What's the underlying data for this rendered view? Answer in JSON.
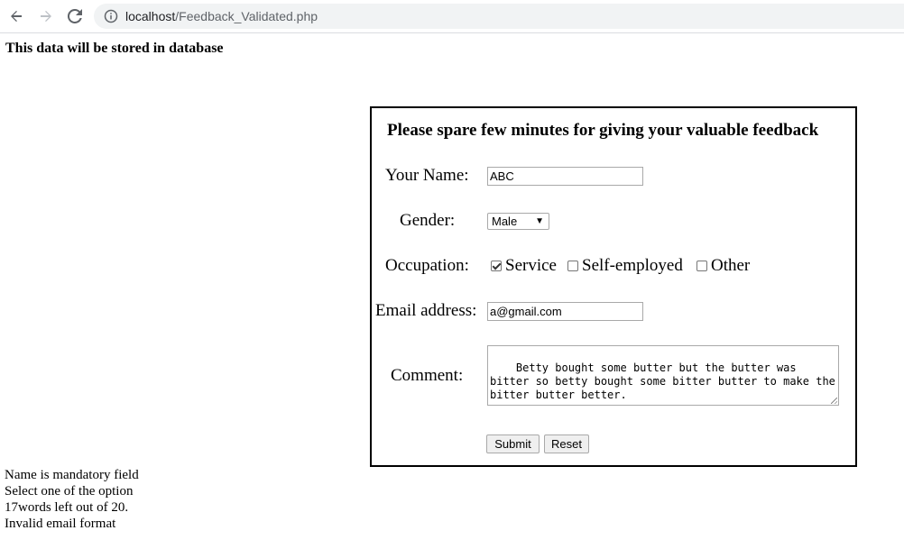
{
  "browser": {
    "url_host": "localhost",
    "url_path": "/Feedback_Validated.php"
  },
  "page": {
    "stored_message": "This data will be stored in database"
  },
  "form": {
    "heading": "Please spare few minutes for giving your valuable feedback",
    "name_label": "Your Name:",
    "name_value": "ABC",
    "gender_label": "Gender:",
    "gender_selected": "Male",
    "occupation_label": "Occupation:",
    "occupation_options": [
      {
        "label": "Service",
        "checked": true
      },
      {
        "label": "Self-employed",
        "checked": false
      },
      {
        "label": "Other",
        "checked": false
      }
    ],
    "email_label": "Email address:",
    "email_value": "a@gmail.com",
    "comment_label": "Comment:",
    "comment_value": "Betty bought some butter but the butter was bitter so betty bought some bitter butter to make the bitter butter better.",
    "submit_label": "Submit",
    "reset_label": "Reset"
  },
  "errors": [
    "Name is mandatory field",
    "Select one of the option",
    "17words left out of 20.",
    "Invalid email format"
  ]
}
